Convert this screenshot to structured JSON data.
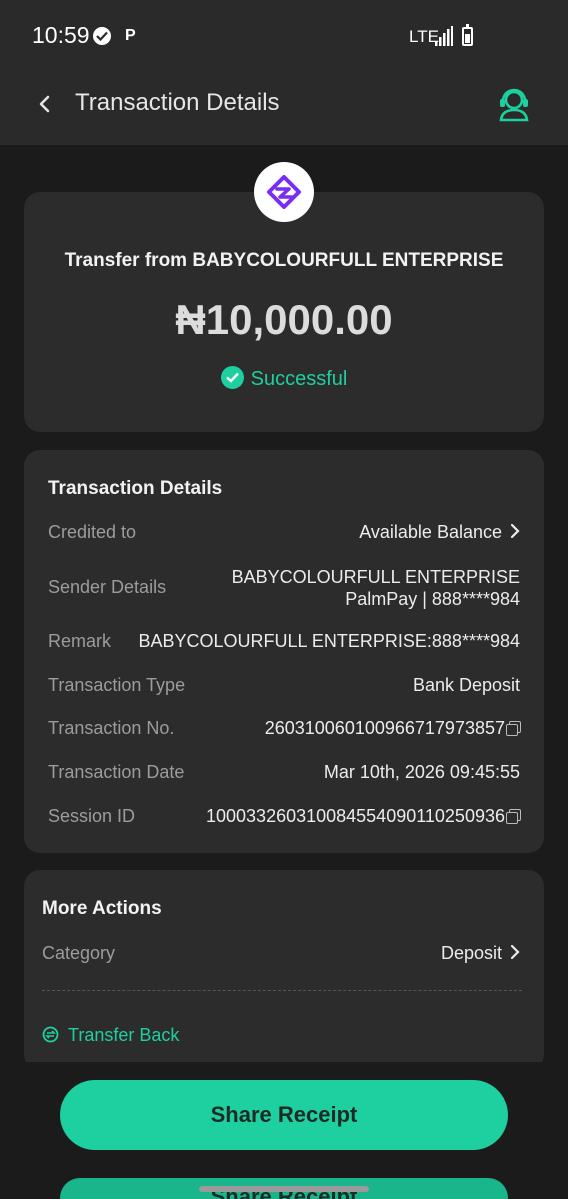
{
  "status_bar": {
    "time": "10:59",
    "notification": "P",
    "network": "LTE"
  },
  "header": {
    "title": "Transaction Details",
    "back_icon": "chevron-left-icon",
    "support_icon": "customer-support-icon"
  },
  "summary": {
    "title": "Transfer from BABYCOLOURFULL ENTERPRISE",
    "amount": "₦10,000.00",
    "status": "Successful"
  },
  "details": {
    "section_title": "Transaction Details",
    "credited_to": {
      "label": "Credited to",
      "value": "Available Balance"
    },
    "sender": {
      "label": "Sender Details",
      "value_line1": "BABYCOLOURFULL ENTERPRISE",
      "value_line2": "PalmPay | 888****984"
    },
    "remark": {
      "label": "Remark",
      "value": "BABYCOLOURFULL ENTERPRISE:888****984"
    },
    "type": {
      "label": "Transaction Type",
      "value": "Bank Deposit"
    },
    "number": {
      "label": "Transaction No.",
      "value": "260310060100966717973857"
    },
    "date": {
      "label": "Transaction Date",
      "value": "Mar 10th, 2026 09:45:55"
    },
    "session": {
      "label": "Session ID",
      "value": "100033260310084554090110250936"
    }
  },
  "actions": {
    "section_title": "More Actions",
    "category": {
      "label": "Category",
      "value": "Deposit"
    },
    "transfer_back": "Transfer Back"
  },
  "footer": {
    "share_label": "Share Receipt"
  },
  "colors": {
    "accent": "#1ecf9f",
    "background": "#1b1b1b",
    "card": "#2c2c2c",
    "logo_purple": "#7a2cf2"
  }
}
